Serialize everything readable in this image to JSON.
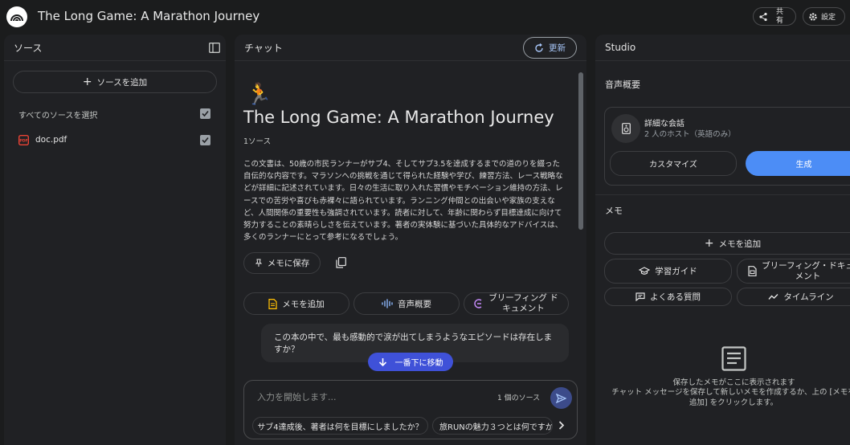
{
  "app": {
    "title": "The Long Game: A Marathon Journey"
  },
  "topbar": {
    "share_label": "共\n有",
    "settings_label": "設定"
  },
  "sources": {
    "title": "ソース",
    "add_button": "ソースを追加",
    "select_all": "すべてのソースを選択",
    "items": [
      {
        "name": "doc.pdf"
      }
    ]
  },
  "chat": {
    "title": "チャット",
    "refresh_button": "更新",
    "emoji": "🏃",
    "notebook_title": "The Long Game: A Marathon Journey",
    "source_count": "1ソース",
    "summary": "この文書は、50歳の市民ランナーがサブ4、そしてサブ3.5を達成するまでの道のりを綴った自伝的な内容です。マラソンへの挑戦を通じて得られた経験や学び、練習方法、レース戦略などが詳細に記述されています。日々の生活に取り入れた習慣やモチベーション維持の方法、レースでの苦労や喜びも赤裸々に語られています。ランニング仲間との出会いや家族の支えなど、人間関係の重要性も強調されています。読者に対して、年齢に関わらず目標達成に向けて努力することの素晴らしさを伝えています。著者の実体験に基づいた具体的なアドバイスは、多くのランナーにとって参考になるでしょう。",
    "save_memo": "メモに保存",
    "actions": {
      "add_memo": "メモを追加",
      "audio": "音声概要",
      "briefing": "ブリーフィング ド\nキュメント"
    },
    "user_message": "この本の中で、最も感動的で涙が出てしまうようなエピソードは存在しますか？",
    "jump_bottom": "一番下に移動",
    "input_placeholder": "入力を開始します...",
    "input_source_count": "1 個のソース",
    "suggestions": [
      "サブ4達成後、著者は何を目標にしましたか？",
      "旅RUNの魅力３つとは何ですか"
    ]
  },
  "studio": {
    "title": "Studio",
    "audio_section": "音声概要",
    "audio_card_title": "詳細な会話",
    "audio_card_sub": "2 人のホスト（英語のみ）",
    "customize": "カスタマイズ",
    "generate": "生成",
    "memo_section": "メモ",
    "add_memo": "メモを追加",
    "study_guide": "学習ガイド",
    "briefing": "ブリーフィング・ドキュ\nメント",
    "faq": "よくある質問",
    "timeline": "タイムライン",
    "empty_title": "保存したメモがここに表示されます",
    "empty_body": "チャット メッセージを保存して新しいメモを作成するか、上の [メモを\n追加] をクリックします。"
  },
  "colors": {
    "accent": "#4c8df6",
    "jump_button": "#3f51d8",
    "pdf_red": "#ea4335"
  }
}
